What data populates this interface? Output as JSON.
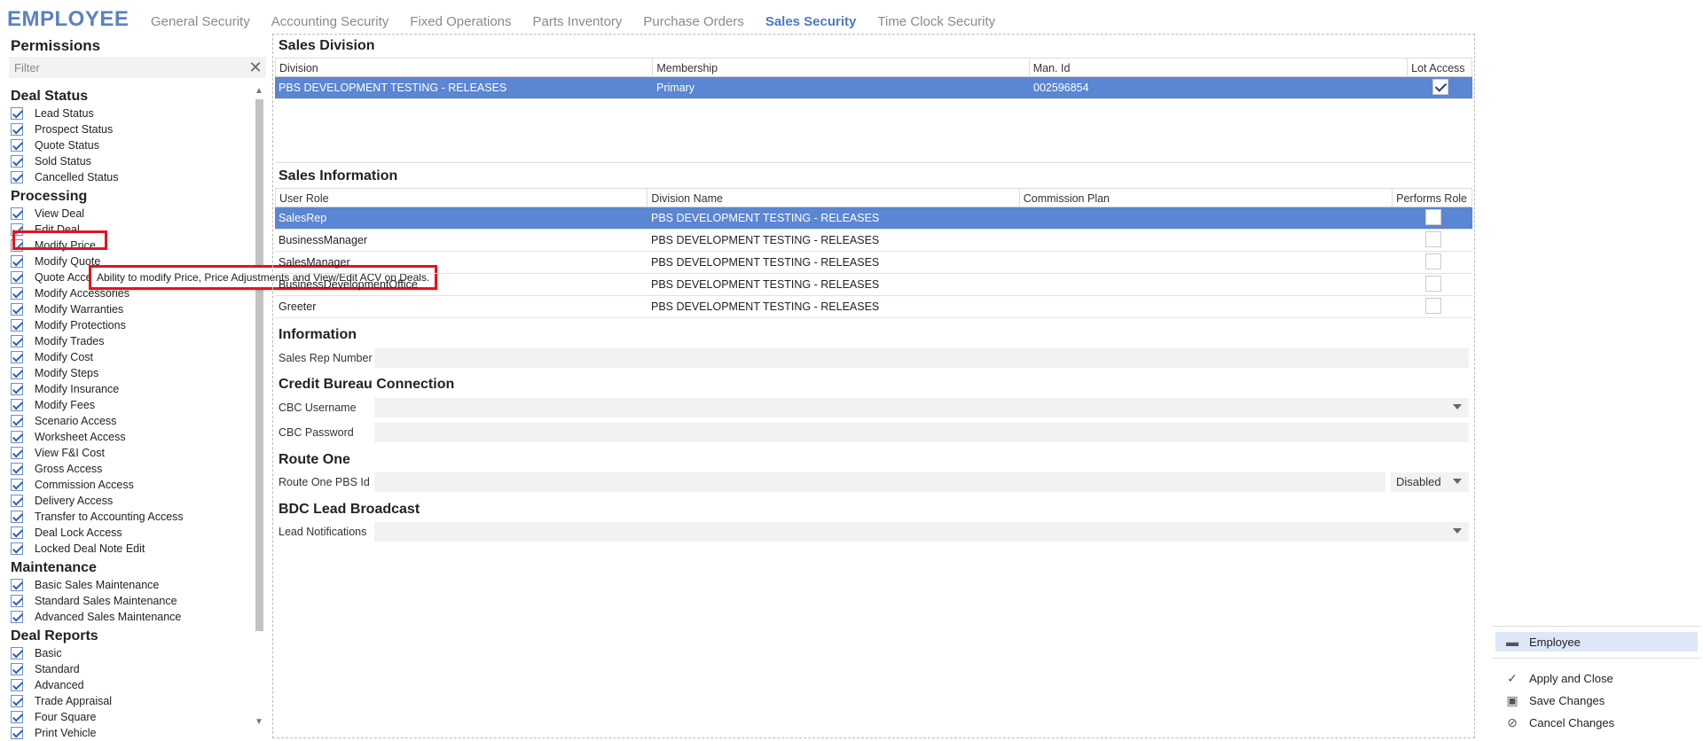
{
  "app": {
    "title": "EMPLOYEE"
  },
  "tabs": [
    "General Security",
    "Accounting Security",
    "Fixed Operations",
    "Parts Inventory",
    "Purchase Orders",
    "Sales Security",
    "Time Clock Security"
  ],
  "active_tab": "Sales Security",
  "permissions": {
    "title": "Permissions",
    "filter_placeholder": "Filter",
    "groups": [
      {
        "name": "Deal Status",
        "items": [
          "Lead Status",
          "Prospect Status",
          "Quote Status",
          "Sold Status",
          "Cancelled Status"
        ]
      },
      {
        "name": "Processing",
        "items": [
          "View Deal",
          "Edit Deal",
          "Modify Price",
          "Modify Quote",
          "Quote Access",
          "Modify Accessories",
          "Modify Warranties",
          "Modify Protections",
          "Modify Trades",
          "Modify Cost",
          "Modify Steps",
          "Modify Insurance",
          "Modify Fees",
          "Scenario Access",
          "Worksheet Access",
          "View F&I Cost",
          "Gross Access",
          "Commission Access",
          "Delivery Access",
          "Transfer to Accounting Access",
          "Deal Lock Access",
          "Locked Deal Note Edit"
        ]
      },
      {
        "name": "Maintenance",
        "items": [
          "Basic Sales Maintenance",
          "Standard Sales Maintenance",
          "Advanced Sales Maintenance"
        ]
      },
      {
        "name": "Deal Reports",
        "items": [
          "Basic",
          "Standard",
          "Advanced",
          "Trade Appraisal",
          "Four Square",
          "Print Vehicle"
        ]
      }
    ],
    "tooltip": "Ability to modify Price, Price Adjustments and View/Edit ACV on Deals."
  },
  "sales_division": {
    "title": "Sales Division",
    "columns": [
      "Division",
      "Membership",
      "Man. Id",
      "Lot Access"
    ],
    "rows": [
      {
        "division": "PBS DEVELOPMENT TESTING - RELEASES",
        "membership": "Primary",
        "man_id": "002596854",
        "lot_access": true
      }
    ]
  },
  "sales_information": {
    "title": "Sales Information",
    "columns": [
      "User Role",
      "Division Name",
      "Commission Plan",
      "Performs Role"
    ],
    "rows": [
      {
        "role": "SalesRep",
        "division": "PBS DEVELOPMENT TESTING - RELEASES",
        "plan": "",
        "performs": false
      },
      {
        "role": "BusinessManager",
        "division": "PBS DEVELOPMENT TESTING - RELEASES",
        "plan": "",
        "performs": false
      },
      {
        "role": "SalesManager",
        "division": "PBS DEVELOPMENT TESTING - RELEASES",
        "plan": "",
        "performs": false
      },
      {
        "role": "BusinessDevelopmentOffice",
        "division": "PBS DEVELOPMENT TESTING - RELEASES",
        "plan": "",
        "performs": false
      },
      {
        "role": "Greeter",
        "division": "PBS DEVELOPMENT TESTING - RELEASES",
        "plan": "",
        "performs": false
      }
    ]
  },
  "information": {
    "title": "Information",
    "sales_rep_label": "Sales Rep Number",
    "sales_rep_value": ""
  },
  "cbc": {
    "title": "Credit Bureau Connection",
    "username_label": "CBC Username",
    "password_label": "CBC Password"
  },
  "route_one": {
    "title": "Route One",
    "id_label": "Route One PBS Id",
    "status": "Disabled"
  },
  "bdc": {
    "title": "BDC Lead Broadcast",
    "notifications_label": "Lead Notifications"
  },
  "side_actions": {
    "employee": "Employee",
    "apply_close": "Apply and Close",
    "save": "Save Changes",
    "cancel": "Cancel Changes"
  },
  "colors": {
    "accent": "#4d79c4",
    "selection": "#5b86d2",
    "highlight": "#e0161f"
  }
}
